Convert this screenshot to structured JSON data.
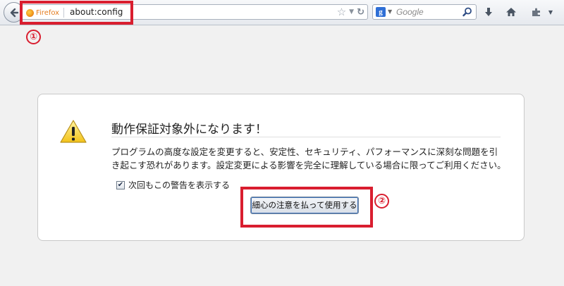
{
  "toolbar": {
    "identity_label": "Firefox",
    "url": "about:config",
    "search_placeholder": "Google",
    "search_engine_letter": "g"
  },
  "annotations": {
    "one": "①",
    "two": "②",
    "color": "#d91e2f"
  },
  "warning": {
    "title": "動作保証対象外になります！",
    "body": "プログラムの高度な設定を変更すると、安定性、セキュリティ、パフォーマンスに深刻な問題を引き起こす恐れがあります。設定変更による影響を完全に理解している場合に限ってご利用ください。",
    "checkbox_label": "次回もこの警告を表示する",
    "checkbox_checked": true,
    "button_label": "細心の注意を払って使用する"
  },
  "icons": {
    "back": "back-arrow-icon",
    "star": "bookmark-star-icon",
    "reload": "reload-icon",
    "search": "magnifier-icon",
    "download": "download-arrow-icon",
    "home": "home-icon",
    "addon": "puzzle-icon",
    "menu": "menu-dropdown-icon",
    "warning": "warning-triangle-icon"
  }
}
